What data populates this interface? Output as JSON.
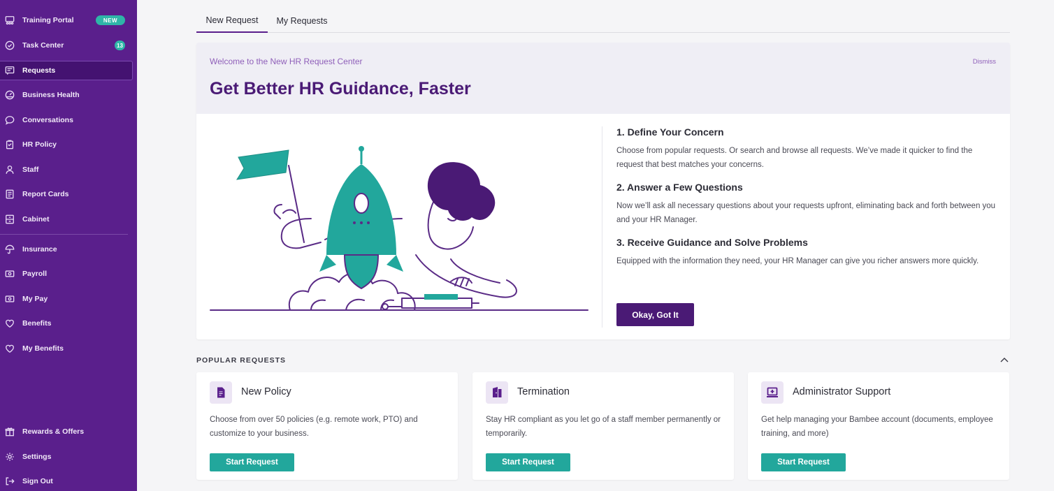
{
  "sidebar": {
    "items": [
      {
        "label": "Training Portal",
        "icon": "training-icon",
        "badge": "NEW"
      },
      {
        "label": "Task Center",
        "icon": "check-circle-icon",
        "badge": "13"
      },
      {
        "label": "Requests",
        "icon": "requests-icon",
        "active": true
      },
      {
        "label": "Business Health",
        "icon": "gauge-icon"
      },
      {
        "label": "Conversations",
        "icon": "chat-bubble-icon"
      },
      {
        "label": "HR Policy",
        "icon": "clipboard-icon"
      },
      {
        "label": "Staff",
        "icon": "user-icon"
      },
      {
        "label": "Report Cards",
        "icon": "report-card-icon"
      },
      {
        "label": "Cabinet",
        "icon": "cabinet-icon"
      },
      {
        "label": "Insurance",
        "icon": "umbrella-icon"
      },
      {
        "label": "Payroll",
        "icon": "payroll-icon"
      },
      {
        "label": "My Pay",
        "icon": "money-icon"
      },
      {
        "label": "Benefits",
        "icon": "heart-icon"
      },
      {
        "label": "My Benefits",
        "icon": "heart-icon"
      },
      {
        "label": "Rewards & Offers",
        "icon": "gift-icon"
      },
      {
        "label": "Settings",
        "icon": "gear-icon"
      },
      {
        "label": "Sign Out",
        "icon": "sign-out-icon"
      }
    ]
  },
  "tabs": [
    {
      "label": "New Request",
      "active": true
    },
    {
      "label": "My Requests",
      "active": false
    }
  ],
  "welcome": {
    "subtitle": "Welcome to the New HR Request Center",
    "title": "Get Better HR Guidance, Faster",
    "dismiss": "Dismiss",
    "steps": [
      {
        "title": "1. Define Your Concern",
        "text": "Choose from popular requests. Or search and browse all requests. We’ve made it quicker to find the request that best matches your concerns."
      },
      {
        "title": "2. Answer a Few Questions",
        "text": "Now we’ll ask all necessary questions about your requests upfront, eliminating back and forth between you and your HR Manager."
      },
      {
        "title": "3. Receive Guidance and Solve Problems",
        "text": "Equipped with the information they need, your HR Manager can give you richer answers more quickly."
      }
    ],
    "button": "Okay, Got It"
  },
  "popular": {
    "label": "POPULAR REQUESTS",
    "cards": [
      {
        "icon": "document-icon",
        "title": "New Policy",
        "desc": "Choose from over 50 policies (e.g. remote work, PTO) and customize to your business.",
        "button": "Start Request"
      },
      {
        "icon": "exit-door-icon",
        "title": "Termination",
        "desc": "Stay HR compliant as you let go of a staff member permanently or temporarily.",
        "button": "Start Request"
      },
      {
        "icon": "laptop-plus-icon",
        "title": "Administrator Support",
        "desc": "Get help managing your Bambee account (documents, employee training, and more)",
        "button": "Start Request"
      }
    ]
  },
  "colors": {
    "brand": "#5a1f8c",
    "accent": "#22a79c",
    "title": "#4a1a75"
  }
}
